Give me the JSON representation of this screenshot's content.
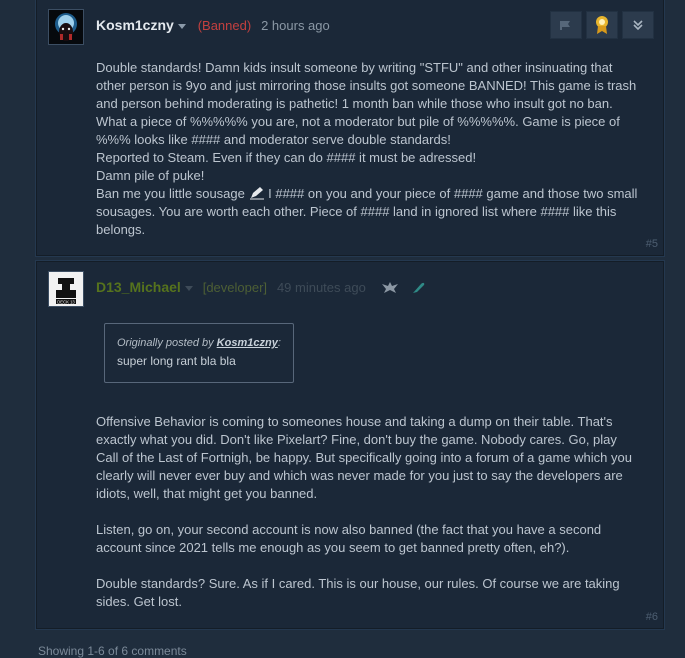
{
  "post1": {
    "author": "Kosm1czny",
    "status": "(Banned)",
    "time": "2 hours ago",
    "lines": [
      "Double standards! Damn kids insult someone by writing \"STFU\" and other insinuating that other person is 9yo and just mirroring those insults got someone BANNED! This game is trash and person behind moderating is pathetic! 1 month ban while those who insult got no ban. What a piece of %%%%% you are, not a moderator but pile of %%%%%. Game is piece of %%% looks like #### and moderator serve double standards!",
      "Reported to Steam. Even if they can do #### it must be adressed!",
      "Damn pile of puke!"
    ],
    "last_before_icon": "Ban me you little sousage",
    "last_after_icon": " I #### on you and your piece of #### game and those two small sousages. You are worth each other. Piece of #### land in ignored list where #### like this belongs.",
    "number": "#5"
  },
  "post2": {
    "author": "D13_Michael",
    "role": "[developer]",
    "time": "49 minutes ago",
    "quote_prefix": "Originally posted by",
    "quote_author": "Kosm1czny",
    "quote_colon": ":",
    "quote_text": "super long rant bla bla",
    "paragraphs": [
      "Offensive Behavior is coming to someones house and taking a dump on their table. That's exactly what you did. Don't like Pixelart? Fine, don't buy the game. Nobody cares. Go, play Call of the Last of Fortnigh, be happy. But specifically going into a forum of a game which you clearly will never ever buy and which was never made for you just to say the developers are idiots, well, that might get you banned.",
      "Listen, go on, your second account is now also banned (the fact that you have a second account since 2021 tells me enough as you seem to get banned pretty often, eh?).",
      "Double standards? Sure. As if I cared. This is our house, our rules. Of course we are taking sides. Get lost."
    ],
    "number": "#6",
    "avatar_label": "DECK 13"
  },
  "footer": {
    "text": "Showing 1-6 of 6 comments"
  },
  "colors": {
    "banned": "#c2403f",
    "developer_name": "#56731d",
    "award": "#e8b52d"
  },
  "icons": [
    "flag-icon",
    "award-icon",
    "collapse-icon",
    "developer-badge-icon",
    "feather-icon",
    "pen-icon"
  ]
}
